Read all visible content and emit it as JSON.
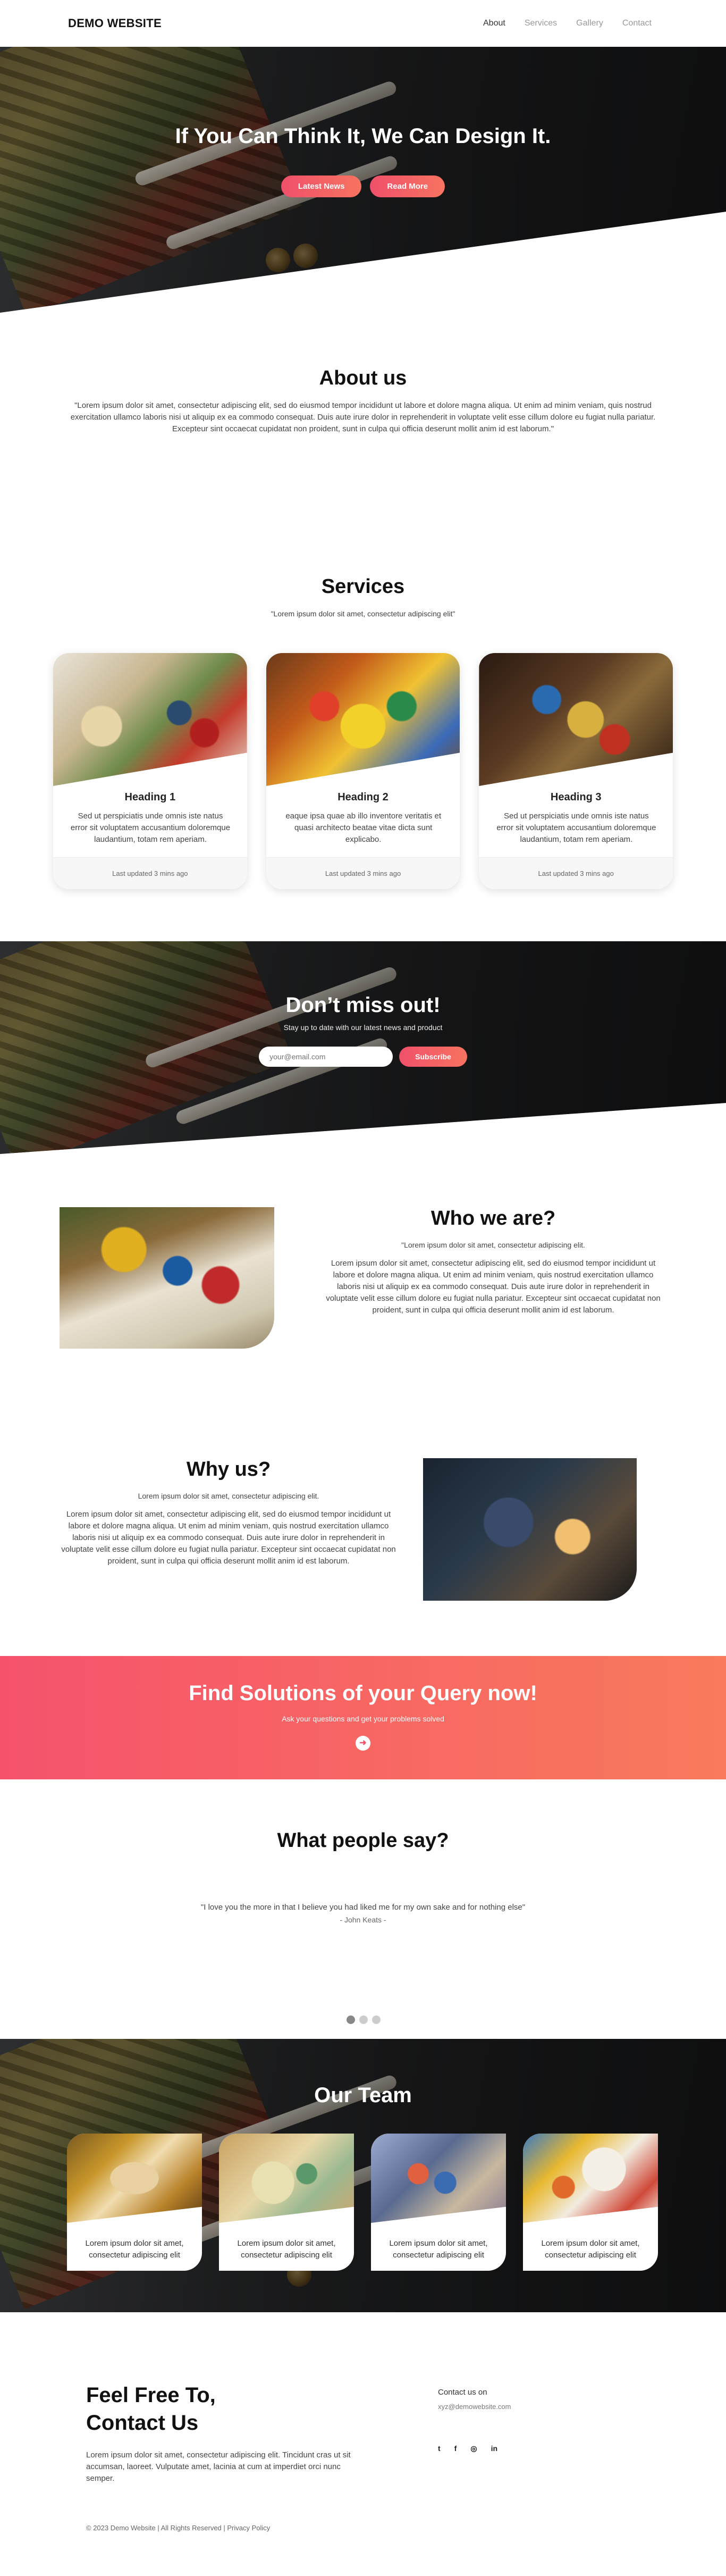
{
  "nav": {
    "logo": "DEMO WEBSITE",
    "links": [
      "About",
      "Services",
      "Gallery",
      "Contact"
    ]
  },
  "hero": {
    "title": "If You Can Think It, We Can Design It.",
    "btn_news": "Latest News",
    "btn_more": "Read More"
  },
  "about": {
    "title": "About us",
    "text": "\"Lorem ipsum dolor sit amet, consectetur adipiscing elit, sed do eiusmod tempor incididunt ut labore et dolore magna aliqua. Ut enim ad minim veniam, quis nostrud exercitation ullamco laboris nisi ut aliquip ex ea commodo consequat. Duis aute irure dolor in reprehenderit in voluptate velit esse cillum dolore eu fugiat nulla pariatur. Excepteur sint occaecat cupidatat non proident, sunt in culpa qui officia deserunt mollit anim id est laborum.\""
  },
  "services": {
    "title": "Services",
    "subtitle": "\"Lorem ipsum dolor sit amet, consectetur adipiscing elit\"",
    "cards": [
      {
        "heading": "Heading 1",
        "text": "Sed ut perspiciatis unde omnis iste natus error sit voluptatem accusantium doloremque laudantium, totam rem aperiam.",
        "updated": "Last updated 3 mins ago"
      },
      {
        "heading": "Heading 2",
        "text": "eaque ipsa quae ab illo inventore veritatis et quasi architecto beatae vitae dicta sunt explicabo.",
        "updated": "Last updated 3 mins ago"
      },
      {
        "heading": "Heading 3",
        "text": "Sed ut perspiciatis unde omnis iste natus error sit voluptatem accusantium doloremque laudantium, totam rem aperiam.",
        "updated": "Last updated 3 mins ago"
      }
    ]
  },
  "newsletter": {
    "title": "Don’t miss out!",
    "subtitle": "Stay up to date with our latest news and product",
    "placeholder": "your@email.com",
    "button": "Subscribe"
  },
  "who": {
    "title": "Who we are?",
    "lead": "\"Lorem ipsum dolor sit amet, consectetur adipiscing elit.",
    "text": "Lorem ipsum dolor sit amet, consectetur adipiscing elit, sed do eiusmod tempor incididunt ut labore et dolore magna aliqua. Ut enim ad minim veniam, quis nostrud exercitation ullamco laboris nisi ut aliquip ex ea commodo consequat. Duis aute irure dolor in reprehenderit in voluptate velit esse cillum dolore eu fugiat nulla pariatur. Excepteur sint occaecat cupidatat non proident, sunt in culpa qui officia deserunt mollit anim id est laborum."
  },
  "why": {
    "title": "Why us?",
    "lead": "Lorem ipsum dolor sit amet, consectetur adipiscing elit.",
    "text": "Lorem ipsum dolor sit amet, consectetur adipiscing elit, sed do eiusmod tempor incididunt ut labore et dolore magna aliqua. Ut enim ad minim veniam, quis nostrud exercitation ullamco laboris nisi ut aliquip ex ea commodo consequat. Duis aute irure dolor in reprehenderit in voluptate velit esse cillum dolore eu fugiat nulla pariatur. Excepteur sint occaecat cupidatat non proident, sunt in culpa qui officia deserunt mollit anim id est laborum."
  },
  "cta": {
    "title": "Find Solutions of your Query now!",
    "subtitle": "Ask your questions and get your problems solved",
    "icon": "arrow-right-circle-icon"
  },
  "testimonial": {
    "title": "What people say?",
    "quote": "\"I love you the more in that I believe you had liked me for my own sake and for nothing else\"",
    "author": "- John Keats -"
  },
  "team": {
    "title": "Our Team",
    "members": [
      {
        "text": "Lorem ipsum dolor sit amet, consectetur adipiscing elit"
      },
      {
        "text": "Lorem ipsum dolor sit amet, consectetur adipiscing elit"
      },
      {
        "text": "Lorem ipsum dolor sit amet, consectetur adipiscing elit"
      },
      {
        "text": "Lorem ipsum dolor sit amet, consectetur adipiscing elit"
      }
    ]
  },
  "footer": {
    "title_line1": "Feel Free To,",
    "title_line2": "Contact Us",
    "text": "Lorem ipsum dolor sit amet, consectetur adipiscing elit. Tincidunt cras ut sit accumsan, laoreet. Vulputate amet, lacinia at cum at imperdiet orci nunc semper.",
    "contact_label": "Contact us on",
    "email": "xyz@demowebsite.com",
    "social": [
      "twitter-icon",
      "facebook-icon",
      "instagram-icon",
      "linkedin-icon"
    ],
    "social_glyphs": [
      "t",
      "f",
      "◎",
      "in"
    ],
    "copyright": "© 2023 Demo Website | All Rights Reserved | Privacy Policy"
  },
  "colors": {
    "accent": "#f4566c",
    "accent_end": "#f97a5c",
    "dark": "#2b2c2e"
  }
}
